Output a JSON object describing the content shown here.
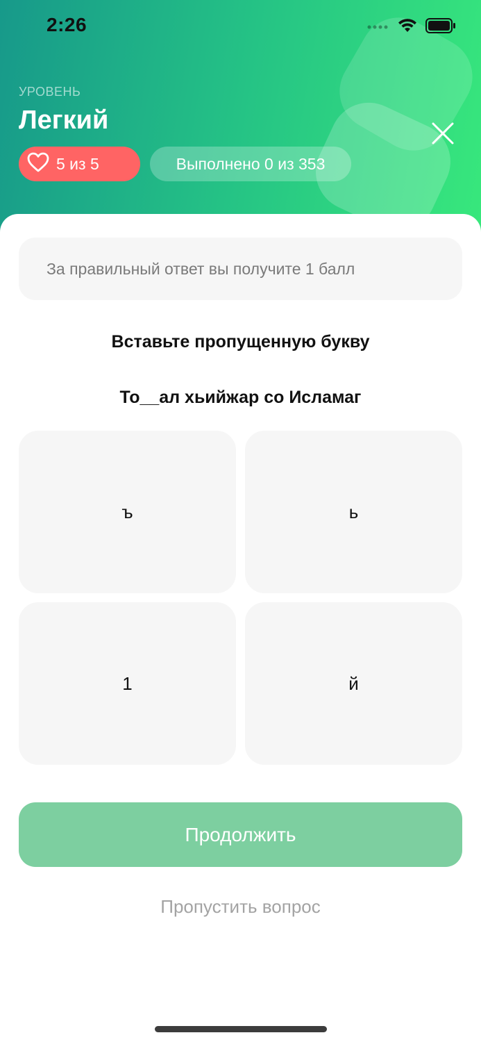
{
  "status_bar": {
    "time": "2:26"
  },
  "header": {
    "level_label": "УРОВЕНЬ",
    "level_title": "Легкий",
    "lives_text": "5 из 5",
    "progress_text": "Выполнено 0 из 353"
  },
  "quiz": {
    "info_text": "За правильный ответ вы получите 1 балл",
    "instruction": "Вставьте пропущенную букву",
    "question": "То__ал хьийжар со Исламаг",
    "options": [
      "ъ",
      "ь",
      "1",
      "й"
    ]
  },
  "actions": {
    "continue_label": "Продолжить",
    "skip_label": "Пропустить вопрос"
  },
  "colors": {
    "gradient_start": "#17998a",
    "gradient_end": "#38e87c",
    "lives_pill": "#ff6464",
    "continue_button": "#7dcfa0"
  },
  "icons": [
    "wifi-icon",
    "battery-icon",
    "signal-icon",
    "heart-icon",
    "close-icon"
  ]
}
